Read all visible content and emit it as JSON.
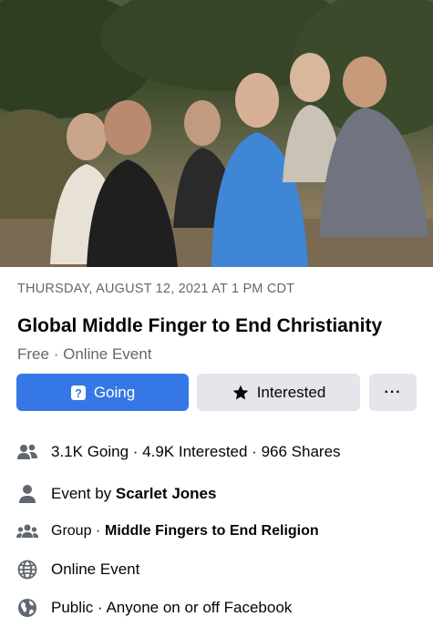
{
  "event": {
    "date_line": "THURSDAY, AUGUST 12, 2021 AT 1 PM CDT",
    "title": "Global Middle Finger to End Christianity",
    "price": "Free",
    "separator": "·",
    "type": "Online Event"
  },
  "actions": {
    "going_label": "Going",
    "interested_label": "Interested",
    "more_label": "···"
  },
  "details": {
    "stats": "3.1K Going · 4.9K Interested · 966 Shares",
    "host_prefix": "Event by",
    "host_name": "Scarlet Jones",
    "group_prefix": "Group ·",
    "group_name": "Middle Fingers to End Religion",
    "location": "Online Event",
    "privacy": "Public · Anyone on or off Facebook"
  },
  "icons": {
    "stats": "people-icon",
    "host": "person-icon",
    "group": "group-icon",
    "location": "globe-icon",
    "privacy": "public-earth-icon"
  },
  "colors": {
    "primary": "#3578e5",
    "secondary_button": "#e4e6eb",
    "muted_text": "#65676b",
    "icon_gray": "#606770"
  }
}
